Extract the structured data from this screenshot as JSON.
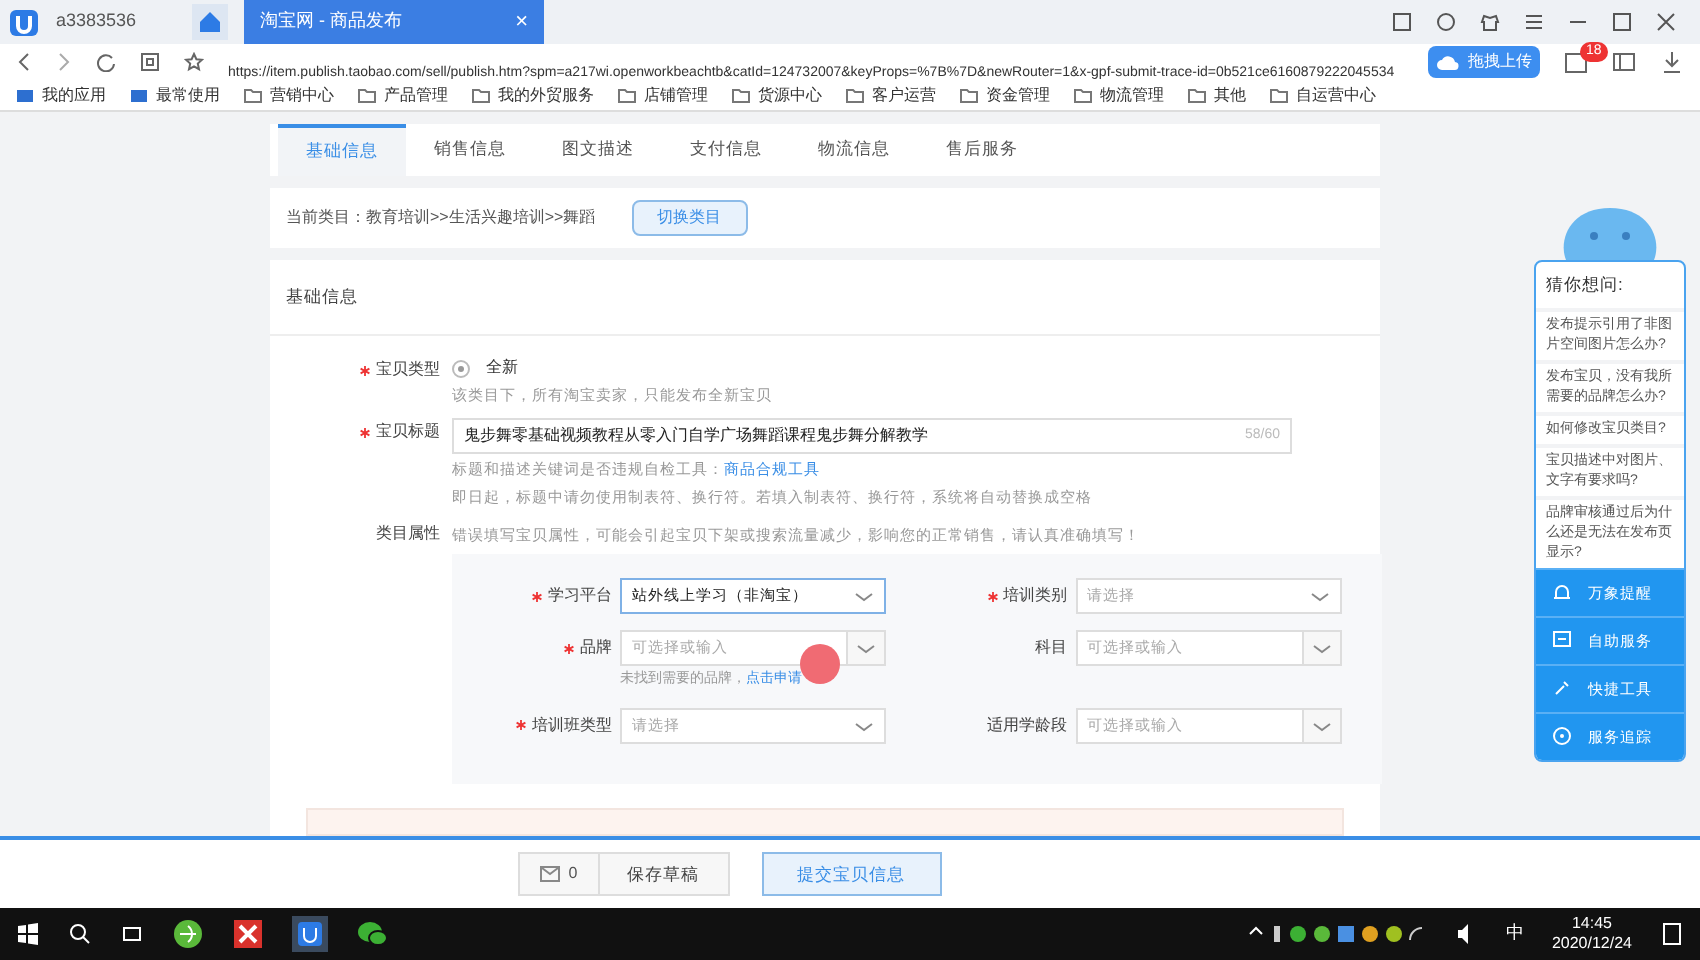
{
  "browser": {
    "account": "a3383536",
    "tabs": [
      {
        "title": "淘宝网 - 商品发布",
        "selected": true,
        "close": "×"
      }
    ],
    "url": "https://item.publish.taobao.com/sell/publish.htm?spm=a217wi.openworkbeachtb&catId=124732007&keyProps=%7B%7D&newRouter=1&x-gpf-submit-trace-id=0b521ce6160879222045534",
    "upload_label": "拖拽上传",
    "badge": "18",
    "bookmarks": [
      {
        "label": "我的应用",
        "kind": "app"
      },
      {
        "label": "最常使用",
        "kind": "app"
      },
      {
        "label": "营销中心",
        "kind": "folder"
      },
      {
        "label": "产品管理",
        "kind": "folder"
      },
      {
        "label": "我的外贸服务",
        "kind": "folder"
      },
      {
        "label": "店铺管理",
        "kind": "folder"
      },
      {
        "label": "货源中心",
        "kind": "folder"
      },
      {
        "label": "客户运营",
        "kind": "folder"
      },
      {
        "label": "资金管理",
        "kind": "folder"
      },
      {
        "label": "物流管理",
        "kind": "folder"
      },
      {
        "label": "其他",
        "kind": "folder"
      },
      {
        "label": "自运营中心",
        "kind": "folder"
      }
    ]
  },
  "section_tabs": [
    {
      "label": "基础信息",
      "selected": true
    },
    {
      "label": "销售信息",
      "selected": false
    },
    {
      "label": "图文描述",
      "selected": false
    },
    {
      "label": "支付信息",
      "selected": false
    },
    {
      "label": "物流信息",
      "selected": false
    },
    {
      "label": "售后服务",
      "selected": false
    }
  ],
  "category": {
    "text": "当前类目：教育培训>>生活兴趣培训>>舞蹈",
    "button": "切换类目"
  },
  "form": {
    "title": "基础信息",
    "item_type": {
      "label": "宝贝类型",
      "required": true,
      "option": "全新",
      "checked": true,
      "hint": "该类目下，所有淘宝卖家，只能发布全新宝贝"
    },
    "item_title": {
      "label": "宝贝标题",
      "required": true,
      "value": "鬼步舞零基础视频教程从零入门自学广场舞蹈课程鬼步舞分解教学",
      "count": "58/60",
      "hint": "标题和描述关键词是否违规自检工具：",
      "hint_link": "商品合规工具",
      "note": "即日起，标题中请勿使用制表符、换行符。若填入制表符、换行符，系统将自动替换成空格"
    },
    "attributes": {
      "label": "类目属性",
      "hint": "错误填写宝贝属性，可能会引起宝贝下架或搜索流量减少，影响您的正常销售，请认真准确填写！",
      "fields": [
        {
          "label": "学习平台",
          "required": true,
          "value": "站外线上学习（非淘宝）",
          "kind": "select"
        },
        {
          "label": "培训类别",
          "required": true,
          "placeholder": "请选择",
          "kind": "select"
        },
        {
          "label": "品牌",
          "required": true,
          "placeholder": "可选择或输入",
          "kind": "combo",
          "hint": "未找到需要的品牌，",
          "hint_link": "点击申请"
        },
        {
          "label": "科目",
          "required": false,
          "placeholder": "可选择或输入",
          "kind": "combo"
        },
        {
          "label": "培训班类型",
          "required": true,
          "placeholder": "请选择",
          "kind": "select"
        },
        {
          "label": "适用学龄段",
          "required": false,
          "placeholder": "可选择或输入",
          "kind": "combo"
        }
      ]
    }
  },
  "assistant": {
    "title": "猜你想问:",
    "questions": [
      "发布提示引用了非图片空间图片怎么办?",
      "发布宝贝，没有我所需要的品牌怎么办?",
      "如何修改宝贝类目?",
      "宝贝描述中对图片、文字有要求吗?",
      "品牌审核通过后为什么还是无法在发布页显示?"
    ],
    "actions": [
      "万象提醒",
      "自助服务",
      "快捷工具",
      "服务追踪"
    ]
  },
  "footer": {
    "message_count": "0",
    "save": "保存草稿",
    "submit": "提交宝贝信息"
  },
  "taskbar": {
    "time": "14:45",
    "date": "2020/12/24",
    "ime": "中"
  }
}
